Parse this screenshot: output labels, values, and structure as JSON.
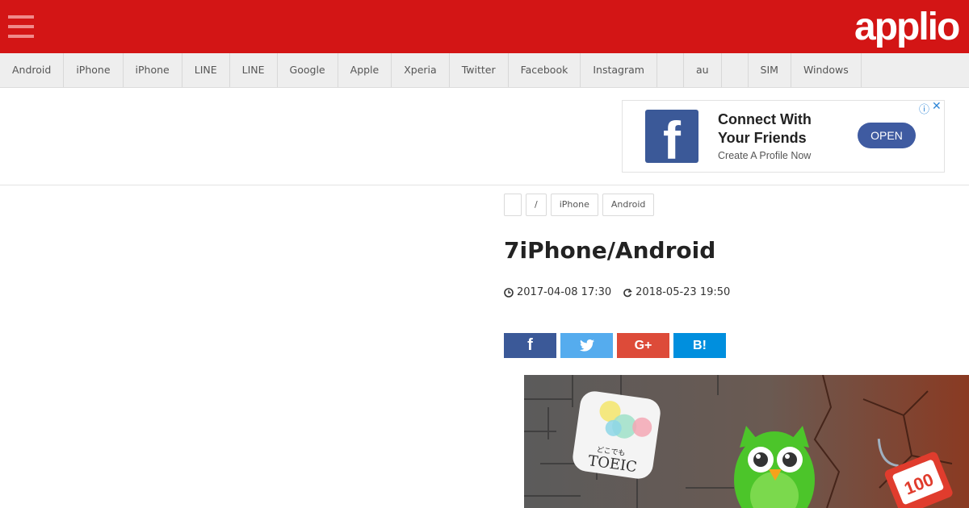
{
  "header": {
    "logo_text": "applio",
    "brand_color": "#d31515"
  },
  "categories": [
    "Android",
    "iPhone",
    "iPhone",
    "LINE",
    "LINE",
    "Google",
    "Apple",
    "Xperia",
    "Twitter",
    "Facebook",
    "Instagram",
    "",
    "au",
    "",
    "SIM",
    "Windows"
  ],
  "ad": {
    "headline": "Connect With Your Friends",
    "subtext": "Create A Profile Now",
    "button_label": "OPEN",
    "info_icon": "ⓘ",
    "close_icon": "✕"
  },
  "article": {
    "breadcrumbs": [
      "",
      "/",
      "iPhone",
      "Android"
    ],
    "title": "7iPhone/Android",
    "published": "2017-04-08 17:30",
    "updated": "2018-05-23 19:50",
    "share": {
      "facebook": "f",
      "twitter": "twitter-bird-icon",
      "google_plus": "G+",
      "hatena": "B!"
    },
    "hero": {
      "app_icon_text": "TOEIC",
      "app_icon_kana": "どこでも",
      "tag_text": "100"
    }
  }
}
